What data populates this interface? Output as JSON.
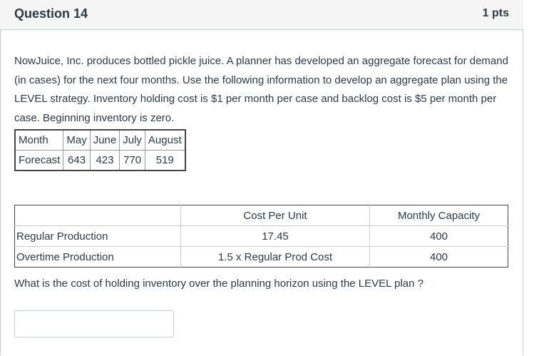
{
  "header": {
    "title": "Question 14",
    "points": "1 pts"
  },
  "prompt": {
    "text": "NowJuice, Inc. produces bottled pickle juice.  A planner has developed an aggregate forecast for demand (in cases) for the next four months.  Use the following information to develop an aggregate plan using the LEVEL strategy.  Inventory holding cost is $1 per month per case and backlog cost is $5 per month per case.  Beginning inventory is zero."
  },
  "forecast_table": {
    "row1": [
      "Month",
      "May",
      "June",
      "July",
      "August"
    ],
    "row2": [
      "Forecast",
      "643",
      "423",
      "770",
      "519"
    ]
  },
  "cost_table": {
    "header": [
      "",
      "Cost Per Unit",
      "Monthly Capacity"
    ],
    "rows": [
      [
        "Regular Production",
        "17.45",
        "400"
      ],
      [
        "Overtime Production",
        "1.5  x Regular Prod Cost",
        "400"
      ]
    ]
  },
  "question": {
    "text": "What is the cost of holding inventory over the planning horizon using the LEVEL plan ?"
  },
  "answer": {
    "value": ""
  }
}
